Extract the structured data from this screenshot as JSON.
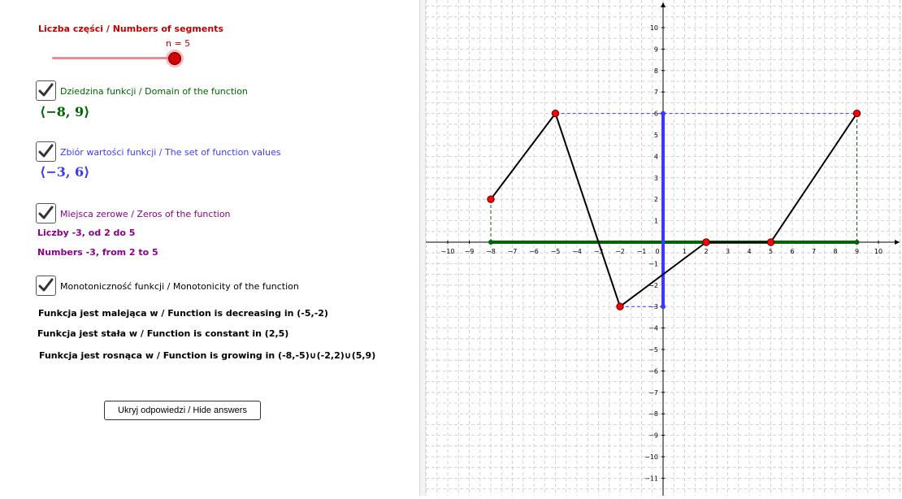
{
  "slider": {
    "title": "Liczba części / Numbers of segments",
    "value_label": "n = 5",
    "value": 5
  },
  "domain": {
    "label": "Dziedzina funkcji / Domain of the function",
    "value": "⟨−8, 9⟩",
    "checked": true
  },
  "range": {
    "label": "Zbiór wartości funkcji / The set of function values",
    "value": "⟨−3, 6⟩",
    "checked": true
  },
  "zeros": {
    "label": "Miejsca zerowe / Zeros of the function",
    "line1": "Liczby -3, od 2 do 5",
    "line2": "Numbers -3, from 2 to 5",
    "checked": true
  },
  "monotonicity": {
    "label": "Monotoniczność funkcji / Monotonicity of the function",
    "decreasing": "Funkcja jest malejąca w / Function is decreasing in (-5,-2)",
    "constant": "Funkcja jest stała w / Function is constant in (2,5)",
    "growing": "Funkcja jest rosnąca w / Function is growing in (-8,-5)∪(-2,2)∪(5,9)",
    "checked": true
  },
  "hide_button": {
    "label": "Ukryj odpowiedzi / Hide answers"
  },
  "colors": {
    "title": "#c00000",
    "domain": "#006400",
    "range": "#3a3aff",
    "zeros": "#8b008b",
    "points": "#ff0000"
  },
  "chart_data": {
    "type": "line",
    "x_ticks": [
      -10,
      -9,
      -8,
      -7,
      -6,
      -5,
      -4,
      -3,
      -2,
      -1,
      0,
      1,
      2,
      3,
      4,
      5,
      6,
      7,
      8,
      9,
      10
    ],
    "y_ticks": [
      -11,
      -10,
      -9,
      -8,
      -7,
      -6,
      -5,
      -4,
      -3,
      -2,
      -1,
      0,
      1,
      2,
      3,
      4,
      5,
      6,
      7,
      8,
      9,
      10
    ],
    "xlim": [
      -10.9,
      11.1
    ],
    "ylim": [
      -11.5,
      11.2
    ],
    "grid": true,
    "series": [
      {
        "x": [
          -8,
          -5,
          -2,
          2,
          5,
          9
        ],
        "y": [
          2,
          6,
          -3,
          0,
          0,
          6
        ]
      }
    ],
    "points": [
      {
        "x": -8,
        "y": 2
      },
      {
        "x": -5,
        "y": 6
      },
      {
        "x": -2,
        "y": -3
      },
      {
        "x": 2,
        "y": 0
      },
      {
        "x": 5,
        "y": 0
      },
      {
        "x": 9,
        "y": 6
      }
    ],
    "domain_interval": [
      -8,
      9
    ],
    "range_interval": [
      -3,
      6
    ]
  }
}
